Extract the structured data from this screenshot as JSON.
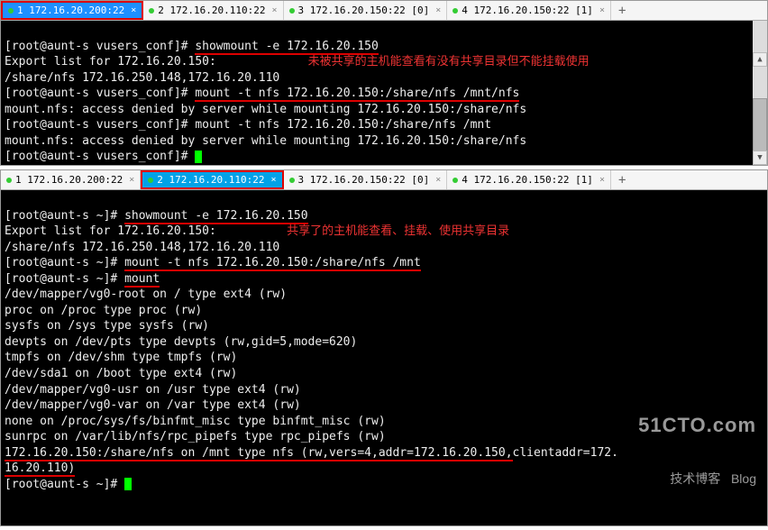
{
  "panel1": {
    "tabs": [
      {
        "label": "1 172.16.20.200:22",
        "active": true,
        "close_glyph": "×"
      },
      {
        "label": "2 172.16.20.110:22",
        "close_glyph": "×"
      },
      {
        "label": "3 172.16.20.150:22 [0]",
        "close_glyph": "×"
      },
      {
        "label": "4 172.16.20.150:22 [1]",
        "close_glyph": "×"
      }
    ],
    "add_glyph": "+",
    "term": {
      "l1_prompt": "[root@aunt-s vusers_conf]# ",
      "l1_cmd": "showmount -e 172.16.20.150",
      "l2": "Export list for 172.16.20.150:",
      "l2_note": "未被共享的主机能查看有没有共享目录但不能挂载使用",
      "l3": "/share/nfs 172.16.250.148,172.16.20.110",
      "l4_prompt": "[root@aunt-s vusers_conf]# ",
      "l4_cmd": "mount -t nfs 172.16.20.150:/share/nfs /mnt/nfs",
      "l5": "mount.nfs: access denied by server while mounting 172.16.20.150:/share/nfs",
      "l6_prompt": "[root@aunt-s vusers_conf]# ",
      "l6_cmd": "mount -t nfs 172.16.20.150:/share/nfs /mnt",
      "l7": "mount.nfs: access denied by server while mounting 172.16.20.150:/share/nfs",
      "l8_prompt": "[root@aunt-s vusers_conf]# "
    }
  },
  "panel2": {
    "tabs": [
      {
        "label": "1 172.16.20.200:22",
        "close_glyph": "×"
      },
      {
        "label": "2 172.16.20.110:22",
        "active": true,
        "close_glyph": "×"
      },
      {
        "label": "3 172.16.20.150:22 [0]",
        "close_glyph": "×"
      },
      {
        "label": "4 172.16.20.150:22 [1]",
        "close_glyph": "×"
      }
    ],
    "add_glyph": "+",
    "term": {
      "l1_prompt": "[root@aunt-s ~]# ",
      "l1_cmd": "showmount -e 172.16.20.150",
      "l2": "Export list for 172.16.20.150:",
      "l2_note": "共享了的主机能查看、挂载、使用共享目录",
      "l3": "/share/nfs 172.16.250.148,172.16.20.110",
      "l4_prompt": "[root@aunt-s ~]# ",
      "l4_cmd": "mount -t nfs 172.16.20.150:/share/nfs /mnt",
      "l5_prompt": "[root@aunt-s ~]# ",
      "l5_cmd": "mount",
      "l6": "/dev/mapper/vg0-root on / type ext4 (rw)",
      "l7": "proc on /proc type proc (rw)",
      "l8": "sysfs on /sys type sysfs (rw)",
      "l9": "devpts on /dev/pts type devpts (rw,gid=5,mode=620)",
      "l10": "tmpfs on /dev/shm type tmpfs (rw)",
      "l11": "/dev/sda1 on /boot type ext4 (rw)",
      "l12": "/dev/mapper/vg0-usr on /usr type ext4 (rw)",
      "l13": "/dev/mapper/vg0-var on /var type ext4 (rw)",
      "l14": "none on /proc/sys/fs/binfmt_misc type binfmt_misc (rw)",
      "l15": "sunrpc on /var/lib/nfs/rpc_pipefs type rpc_pipefs (rw)",
      "l16a": "172.16.20.150:/share/nfs on /mnt type nfs (rw,vers=4,addr=172.16.20.150,",
      "l16b": "clientaddr=172.",
      "l17": "16.20.110)",
      "l18_prompt": "[root@aunt-s ~]# "
    },
    "watermark": {
      "line1": "51CTO.com",
      "line2": "技术博客   Blog"
    }
  }
}
